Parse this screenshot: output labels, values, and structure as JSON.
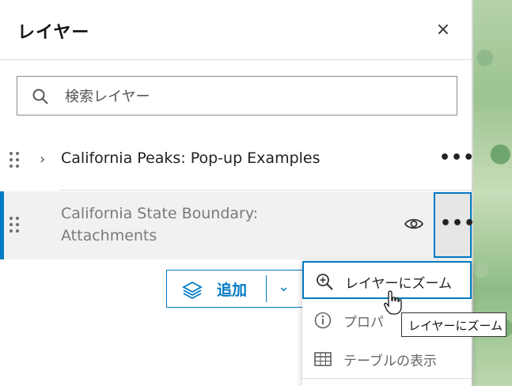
{
  "panel": {
    "title": "レイヤー",
    "close_label": "×"
  },
  "search": {
    "placeholder": "検索レイヤー"
  },
  "layers": [
    {
      "name": "California Peaks: Pop-up Examples"
    },
    {
      "name": "California State Boundary: Attachments"
    }
  ],
  "add_button": {
    "label": "追加"
  },
  "dropdown": {
    "items": [
      {
        "label": "レイヤーにズーム",
        "icon": "zoom-in-icon"
      },
      {
        "label": "プロパ",
        "icon": "info-icon"
      },
      {
        "label": "テーブルの表示",
        "icon": "table-icon"
      }
    ]
  },
  "tooltip": {
    "text": "レイヤーにズーム"
  },
  "colors": {
    "accent": "#007ac2"
  }
}
